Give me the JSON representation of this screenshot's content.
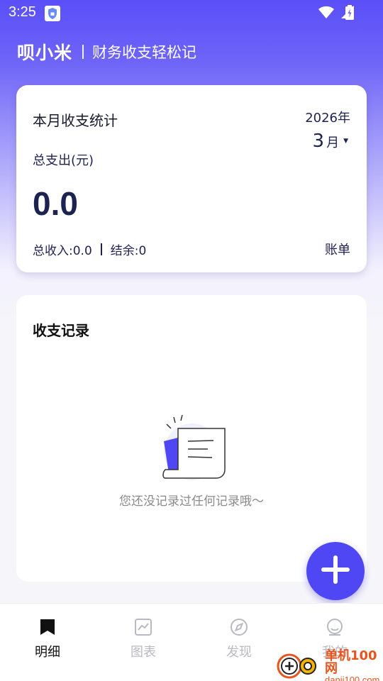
{
  "status_bar": {
    "time": "3:25"
  },
  "header": {
    "app_name": "呗小米",
    "slogan": "财务收支轻松记"
  },
  "stats": {
    "title": "本月收支统计",
    "year": "2026年",
    "month": "3",
    "month_unit": "月",
    "expense_label": "总支出(元)",
    "expense_value": "0.0",
    "income_text": "总收入:0.0",
    "balance_text": "结余:0",
    "bill_link": "账单"
  },
  "records": {
    "title": "收支记录",
    "empty_text": "您还没记录过任何记录哦～"
  },
  "bottom_nav": {
    "items": [
      {
        "label": "明细",
        "icon": "bookmark-icon",
        "active": true
      },
      {
        "label": "图表",
        "icon": "chart-icon",
        "active": false
      },
      {
        "label": "发现",
        "icon": "compass-icon",
        "active": false
      },
      {
        "label": "我的",
        "icon": "profile-icon",
        "active": false
      }
    ]
  },
  "watermark": {
    "name": "单机100网",
    "url": "danji100.com"
  },
  "colors": {
    "accent": "#4f46f4",
    "header_gradient_top": "#5a4ff7",
    "text_dark": "#1c2350"
  }
}
